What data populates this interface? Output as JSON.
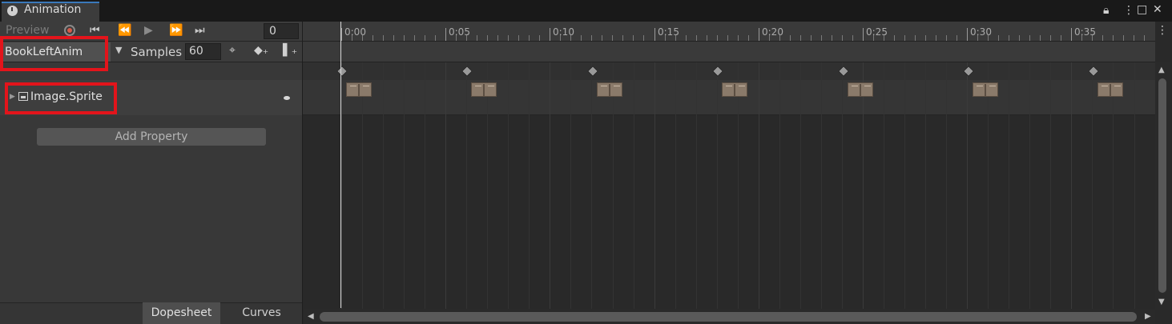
{
  "window": {
    "tab_title": "Animation",
    "lock_icon": "lock-icon",
    "menu_icon": "kebab-menu-icon",
    "maximize_icon": "maximize-icon",
    "close_icon": "close-icon"
  },
  "playback": {
    "preview_label": "Preview",
    "frame_value": "0"
  },
  "clip": {
    "name": "BookLeftAnim",
    "samples_label": "Samples",
    "samples_value": "60"
  },
  "properties": [
    {
      "name": "Image.Sprite"
    }
  ],
  "add_property_label": "Add Property",
  "view_tabs": {
    "dopesheet": "Dopesheet",
    "curves": "Curves"
  },
  "ruler": {
    "labels": [
      "0:00",
      "0:05",
      "0:10",
      "0:15",
      "0:20",
      "0:25",
      "0:30",
      "0:35"
    ]
  },
  "keyframe_count": 7,
  "colors": {
    "highlight": "#e3141b",
    "accent": "#3a79bb",
    "keyframe": "#999999",
    "sprite": "#8a7a6a"
  }
}
